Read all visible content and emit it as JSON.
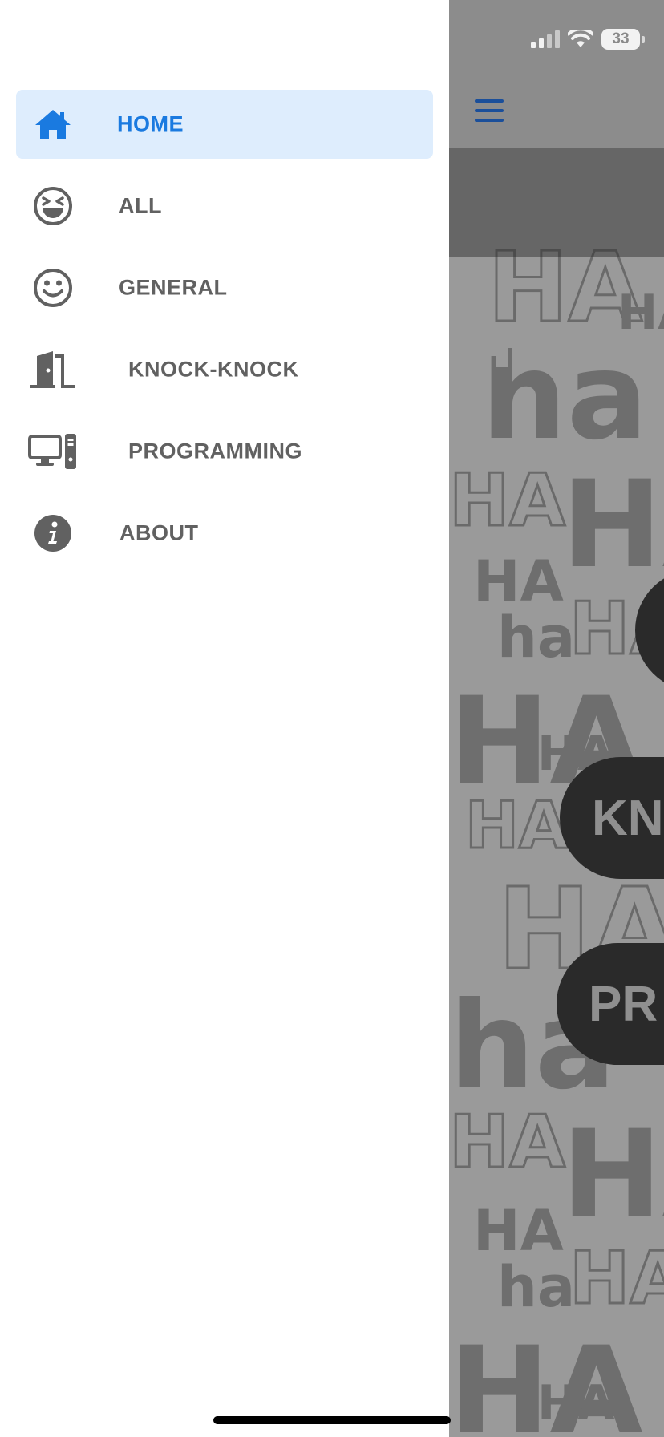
{
  "status_bar": {
    "battery": "33",
    "icons": [
      "cellular-signal-icon",
      "wifi-icon",
      "battery-icon"
    ]
  },
  "app": {
    "menu_icon": "hamburger-menu-icon",
    "nav_icon": "home-icon",
    "pattern_word_upper": "HA",
    "pattern_word_lower": "ha",
    "pills": [
      "KN",
      "PR"
    ]
  },
  "drawer": {
    "items": [
      {
        "label": "HOME",
        "icon": "home-icon",
        "active": true
      },
      {
        "label": "ALL",
        "icon": "laughing-face-icon",
        "active": false
      },
      {
        "label": "GENERAL",
        "icon": "smiley-face-icon",
        "active": false
      },
      {
        "label": "KNOCK-KNOCK",
        "icon": "door-icon",
        "active": false
      },
      {
        "label": "PROGRAMMING",
        "icon": "computer-icon",
        "active": false
      },
      {
        "label": "ABOUT",
        "icon": "info-icon",
        "active": false
      }
    ]
  },
  "colors": {
    "accent": "#1a7ae0",
    "active_bg": "#deedfd",
    "item_text": "#616161",
    "drawer_bg": "#ffffff"
  }
}
